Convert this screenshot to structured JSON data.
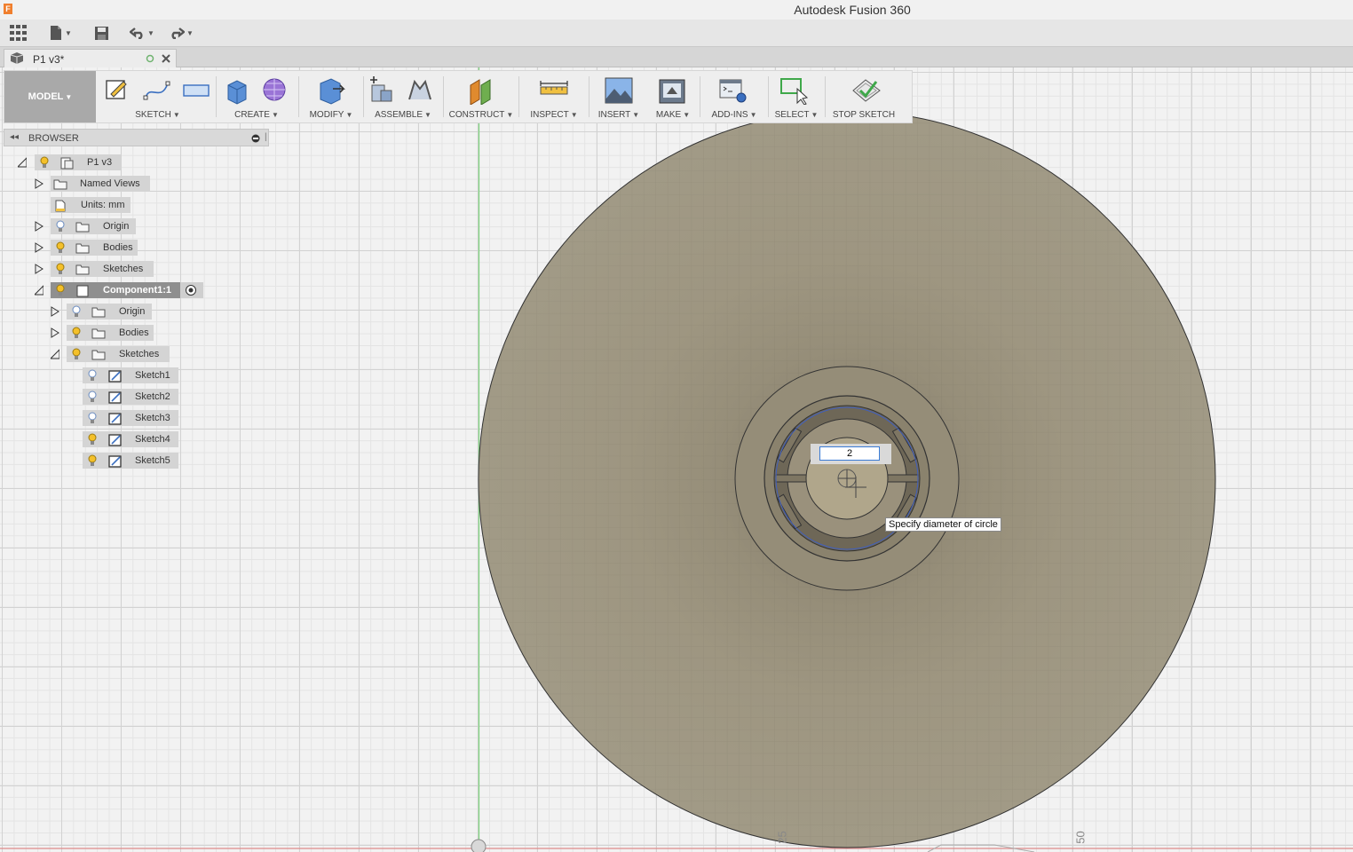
{
  "window": {
    "title": "Autodesk Fusion 360",
    "logo_letter": "F"
  },
  "document_tab": {
    "label": "P1 v3*"
  },
  "toolbar": {
    "workspace": "MODEL",
    "groups": [
      "SKETCH",
      "CREATE",
      "MODIFY",
      "ASSEMBLE",
      "CONSTRUCT",
      "INSPECT",
      "INSERT",
      "MAKE",
      "ADD-INS",
      "SELECT",
      "STOP SKETCH"
    ]
  },
  "browser": {
    "title": "BROWSER",
    "items": [
      {
        "label": "P1 v3"
      },
      {
        "label": "Named Views"
      },
      {
        "label": "Units: mm"
      },
      {
        "label": "Origin"
      },
      {
        "label": "Bodies"
      },
      {
        "label": "Sketches"
      },
      {
        "label": "Component1:1"
      },
      {
        "label": "Origin"
      },
      {
        "label": "Bodies"
      },
      {
        "label": "Sketches"
      },
      {
        "label": "Sketch1"
      },
      {
        "label": "Sketch2"
      },
      {
        "label": "Sketch3"
      },
      {
        "label": "Sketch4"
      },
      {
        "label": "Sketch5"
      }
    ]
  },
  "canvas": {
    "dimension_value": "2",
    "tooltip": "Specify diameter of circle",
    "axis_labels": [
      "25",
      "50"
    ]
  },
  "colors": {
    "accent": "#3a7bd5",
    "body": "#9d9580",
    "toolbar_bg": "#eeeeee",
    "workspace_btn": "#a9a9a9"
  }
}
